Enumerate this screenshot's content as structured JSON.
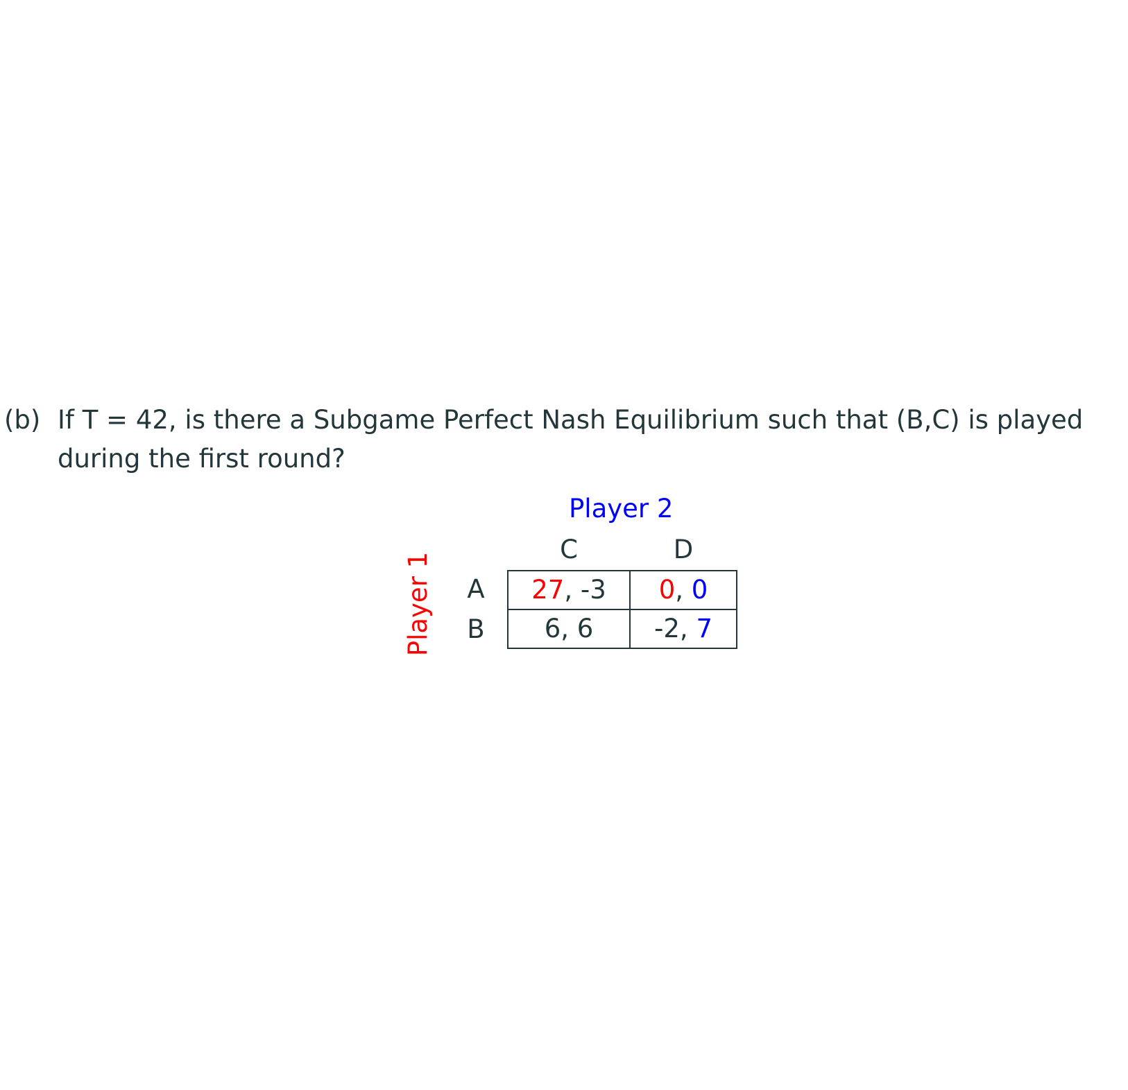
{
  "question": {
    "label": "(b)",
    "line1": "If T = 42, is there a Subgame Perfect Nash Equilibrium such that (B,C) is played",
    "line2": "during the first round?"
  },
  "game": {
    "player2_label": "Player 2",
    "player1_label": "Player 1",
    "columns": [
      "C",
      "D"
    ],
    "rows": [
      "A",
      "B"
    ],
    "cells": [
      [
        {
          "p1": "27",
          "sep": ", ",
          "p2": "-3",
          "p1_color": "#ff0000",
          "p2_color": "#23373b"
        },
        {
          "p1": "0",
          "sep": ", ",
          "p2": "0",
          "p1_color": "#ff0000",
          "p2_color": "#0000ff"
        }
      ],
      [
        {
          "p1": "6",
          "sep": ", ",
          "p2": "6",
          "p1_color": "#23373b",
          "p2_color": "#23373b"
        },
        {
          "p1": "-2",
          "sep": ", ",
          "p2": "7",
          "p1_color": "#23373b",
          "p2_color": "#0000ff"
        }
      ]
    ]
  },
  "colors": {
    "text": "#23373b",
    "player1": "#ff0000",
    "player2": "#0000ff",
    "background": "#ffffff"
  }
}
